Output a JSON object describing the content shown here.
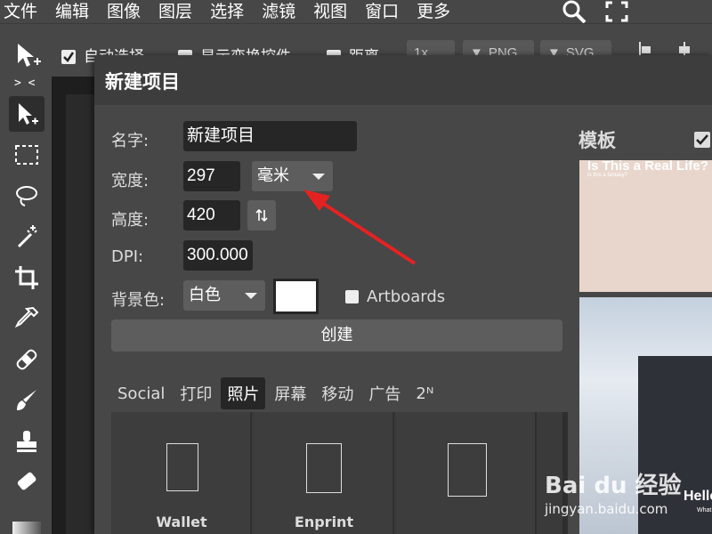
{
  "menubar": {
    "items": [
      "文件",
      "编辑",
      "图像",
      "图层",
      "选择",
      "滤镜",
      "视图",
      "窗口",
      "更多"
    ],
    "icons": [
      "search-icon",
      "fullscreen-icon"
    ]
  },
  "options_bar": {
    "auto_select_label": "自动选择",
    "transform_controls_label": "显示变换控件",
    "distance_label": "距离",
    "zoom_label": "1x",
    "png_label": "PNG",
    "svg_label": "SVG"
  },
  "toolbar": {
    "toggle_label": "> <",
    "tools": [
      "move-tool",
      "marquee-tool",
      "lasso-tool",
      "magic-wand-tool",
      "crop-tool",
      "eyedropper-tool",
      "healing-tool",
      "brush-tool",
      "stamp-tool",
      "eraser-tool"
    ]
  },
  "dialog": {
    "title": "新建项目",
    "name_label": "名字:",
    "name_value": "新建项目",
    "width_label": "宽度:",
    "width_value": "297",
    "unit_value": "毫米",
    "height_label": "高度:",
    "height_value": "420",
    "swap_icon": "swap-icon",
    "dpi_label": "DPI:",
    "dpi_value": "300.000",
    "bg_label": "背景色:",
    "bg_value": "白色",
    "bg_color": "#ffffff",
    "artboards_label": "Artboards",
    "create_label": "创建",
    "tabs": [
      {
        "label": "Social",
        "active": false
      },
      {
        "label": "打印",
        "active": false
      },
      {
        "label": "照片",
        "active": true
      },
      {
        "label": "屏幕",
        "active": false
      },
      {
        "label": "移动",
        "active": false
      },
      {
        "label": "广告",
        "active": false
      },
      {
        "label": "2ᴺ",
        "active": false
      }
    ],
    "presets": [
      "Wallet",
      "Enprint",
      ""
    ]
  },
  "templates": {
    "title": "模板",
    "card1_title": "Is This a Real Life?",
    "card1_sub": "Is this a fantasy?",
    "card2_title": "Hello",
    "card2_sub": "What"
  },
  "watermark": {
    "brand": "Bai du 经验",
    "url": "jingyan.baidu.com"
  },
  "colors": {
    "annotation_arrow": "#e52222"
  }
}
